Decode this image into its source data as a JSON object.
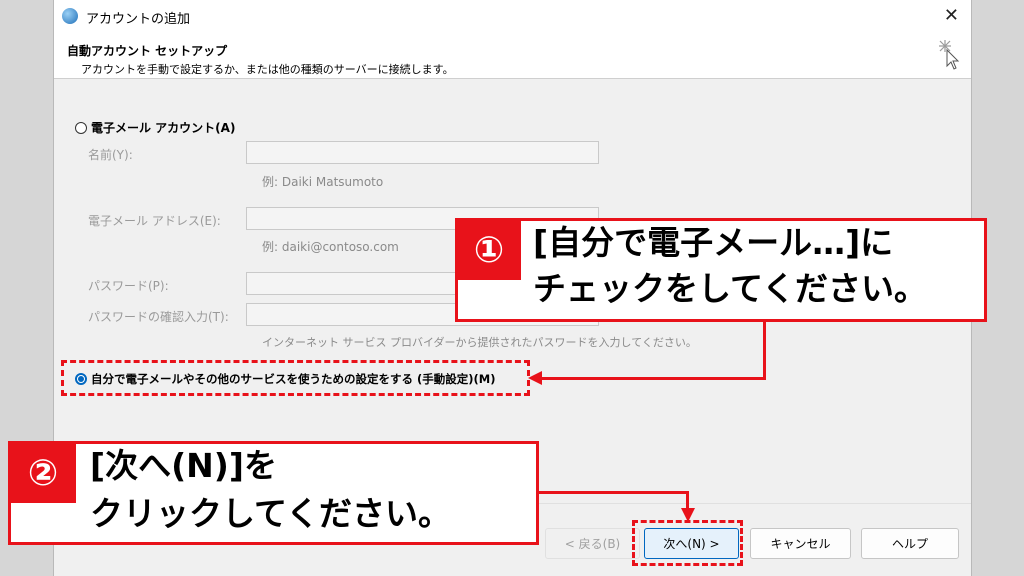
{
  "window": {
    "title": "アカウントの追加",
    "close_glyph": "✕"
  },
  "header": {
    "title": "自動アカウント セットアップ",
    "subtitle": "アカウントを手動で設定するか、または他の種類のサーバーに接続します。"
  },
  "options": {
    "email_account": {
      "label": "電子メール アカウント(A)",
      "selected": false
    },
    "manual_setup": {
      "label": "自分で電子メールやその他のサービスを使うための設定をする (手動設定)(M)",
      "selected": true
    }
  },
  "form": {
    "name_label": "名前(Y):",
    "name_value": "",
    "name_hint": "例: Daiki Matsumoto",
    "email_label": "電子メール アドレス(E):",
    "email_value": "",
    "email_hint": "例: daiki@contoso.com",
    "password_label": "パスワード(P):",
    "password_value": "",
    "password_confirm_label": "パスワードの確認入力(T):",
    "password_confirm_value": "",
    "password_hint": "インターネット サービス プロバイダーから提供されたパスワードを入力してください。"
  },
  "buttons": {
    "back": "< 戻る(B)",
    "next": "次へ(N) >",
    "cancel": "キャンセル",
    "help": "ヘルプ"
  },
  "annotations": {
    "step1": {
      "number": "①",
      "line1": "[自分で電子メール…]に",
      "line2": "チェックをしてください。"
    },
    "step2": {
      "number": "②",
      "line1": "[次へ(N)]を",
      "line2": "クリックしてください。"
    }
  },
  "colors": {
    "annotation": "#e8121a",
    "accent": "#0067c0"
  }
}
